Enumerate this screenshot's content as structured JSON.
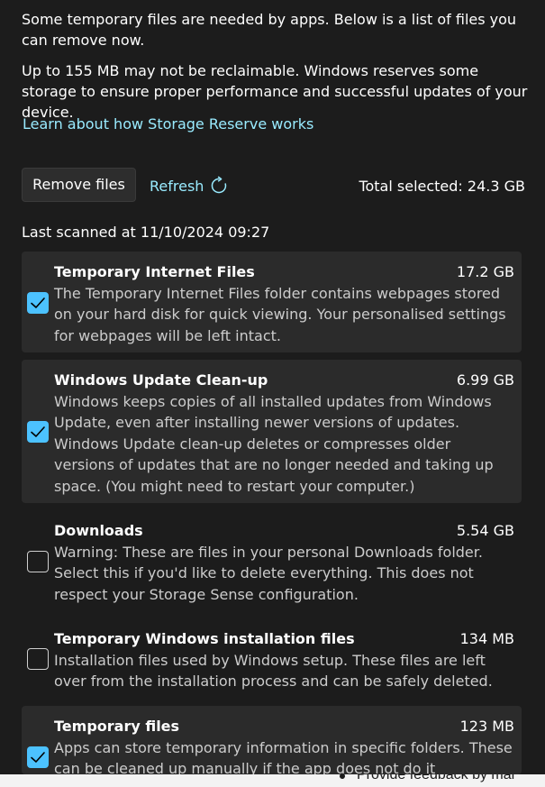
{
  "intro": {
    "text1": "Some temporary files are needed by apps. Below is a list of files you can remove now.",
    "text2": "Up to 155 MB may not be reclaimable. Windows reserves some storage to ensure proper performance and successful updates of your device.",
    "link": "Learn about how Storage Reserve works"
  },
  "toolbar": {
    "remove_label": "Remove files",
    "refresh_label": "Refresh",
    "total_selected": "Total selected: 24.3 GB"
  },
  "last_scanned": "Last scanned at 11/10/2024 09:27",
  "items": [
    {
      "title": "Temporary Internet Files",
      "size": "17.2 GB",
      "checked": true,
      "description": "The Temporary Internet Files folder contains webpages stored on your hard disk for quick viewing. Your personalised settings for webpages will be left intact."
    },
    {
      "title": "Windows Update Clean-up",
      "size": "6.99 GB",
      "checked": true,
      "description": "Windows keeps copies of all installed updates from Windows Update, even after installing newer versions of updates. Windows Update clean-up deletes or compresses older versions of updates that are no longer needed and taking up space. (You might need to restart your computer.)"
    },
    {
      "title": "Downloads",
      "size": "5.54 GB",
      "checked": false,
      "description": "Warning: These are files in your personal Downloads folder. Select this if you'd like to delete everything. This does not respect your Storage Sense configuration."
    },
    {
      "title": "Temporary Windows installation files",
      "size": "134 MB",
      "checked": false,
      "description": "Installation files used by Windows setup. These files are left over from the installation process and can be safely deleted."
    },
    {
      "title": "Temporary files",
      "size": "123 MB",
      "checked": true,
      "description": "Apps can store temporary information in specific folders. These can be cleaned up manually if the app does not do it"
    }
  ],
  "bottom": {
    "text": "Provide feedback by mar"
  },
  "colors": {
    "accent": "#4cc2ff",
    "link": "#99ebff",
    "background": "#1c1c1c",
    "item_selected_bg": "#2b2b2b"
  },
  "icons": {
    "refresh": "refresh-icon",
    "checkmark": "checkmark-icon"
  }
}
